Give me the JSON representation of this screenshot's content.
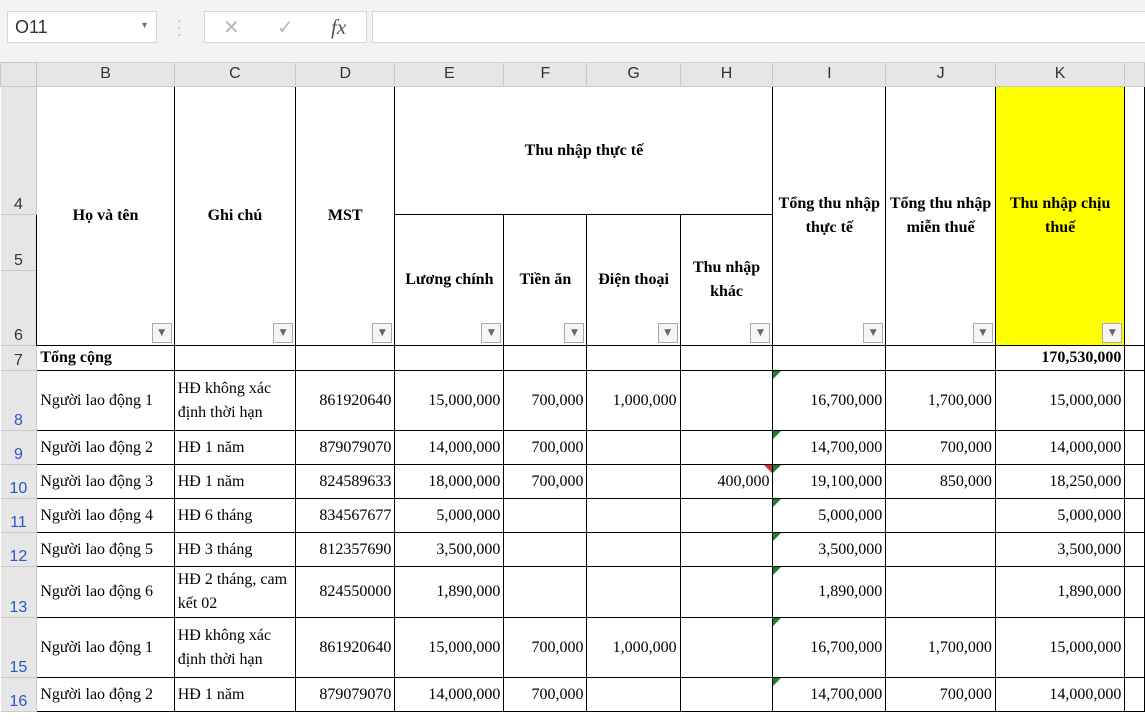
{
  "name_box": "O11",
  "formula_bar": {
    "cancel": "✕",
    "enter": "✓",
    "fx": "fx",
    "value": ""
  },
  "columns": [
    "B",
    "C",
    "D",
    "E",
    "F",
    "G",
    "H",
    "I",
    "J",
    "K"
  ],
  "header": {
    "name": "Họ và tên",
    "note": "Ghi chú",
    "mst": "MST",
    "actual_income": "Thu nhập thực tế",
    "salary": "Lương chính",
    "meal": "Tiền ăn",
    "phone": "Điện thoại",
    "other": "Thu nhập khác",
    "total_actual": "Tổng thu nhập thực tế",
    "total_exempt": "Tổng thu nhập miễn thuế",
    "taxable": "Thu nhập chịu thuế"
  },
  "header_rows": [
    "4",
    "5",
    "6"
  ],
  "total_row": {
    "row": "7",
    "label": "Tổng cộng",
    "taxable": "170,530,000"
  },
  "rows": [
    {
      "row": "8",
      "name": "Người lao động 1",
      "note": "HĐ không xác định thời hạn",
      "mst": "861920640",
      "salary": "15,000,000",
      "meal": "700,000",
      "phone": "1,000,000",
      "other": "",
      "total": "16,700,000",
      "exempt": "1,700,000",
      "taxable": "15,000,000"
    },
    {
      "row": "9",
      "name": "Người lao động 2",
      "note": "HĐ 1 năm",
      "mst": "879079070",
      "salary": "14,000,000",
      "meal": "700,000",
      "phone": "",
      "other": "",
      "total": "14,700,000",
      "exempt": "700,000",
      "taxable": "14,000,000"
    },
    {
      "row": "10",
      "name": "Người lao động 3",
      "note": "HĐ 1 năm",
      "mst": "824589633",
      "salary": "18,000,000",
      "meal": "700,000",
      "phone": "",
      "other": "400,000",
      "total": "19,100,000",
      "exempt": "850,000",
      "taxable": "18,250,000"
    },
    {
      "row": "11",
      "name": "Người lao động 4",
      "note": "HĐ 6 tháng",
      "mst": "834567677",
      "salary": "5,000,000",
      "meal": "",
      "phone": "",
      "other": "",
      "total": "5,000,000",
      "exempt": "",
      "taxable": "5,000,000"
    },
    {
      "row": "12",
      "name": "Người lao động 5",
      "note": "HĐ 3 tháng",
      "mst": "812357690",
      "salary": "3,500,000",
      "meal": "",
      "phone": "",
      "other": "",
      "total": "3,500,000",
      "exempt": "",
      "taxable": "3,500,000"
    },
    {
      "row": "13",
      "name": "Người lao động 6",
      "note": "HĐ 2 tháng, cam kết 02",
      "mst": "824550000",
      "salary": "1,890,000",
      "meal": "",
      "phone": "",
      "other": "",
      "total": "1,890,000",
      "exempt": "",
      "taxable": "1,890,000"
    },
    {
      "row": "15",
      "name": "Người lao động 1",
      "note": "HĐ không xác định thời hạn",
      "mst": "861920640",
      "salary": "15,000,000",
      "meal": "700,000",
      "phone": "1,000,000",
      "other": "",
      "total": "16,700,000",
      "exempt": "1,700,000",
      "taxable": "15,000,000"
    },
    {
      "row": "16",
      "name": "Người lao động 2",
      "note": "HĐ 1 năm",
      "mst": "879079070",
      "salary": "14,000,000",
      "meal": "700,000",
      "phone": "",
      "other": "",
      "total": "14,700,000",
      "exempt": "700,000",
      "taxable": "14,000,000"
    }
  ],
  "colors": {
    "highlight": "#ffff00",
    "row_number_blue": "#2a56c6"
  }
}
